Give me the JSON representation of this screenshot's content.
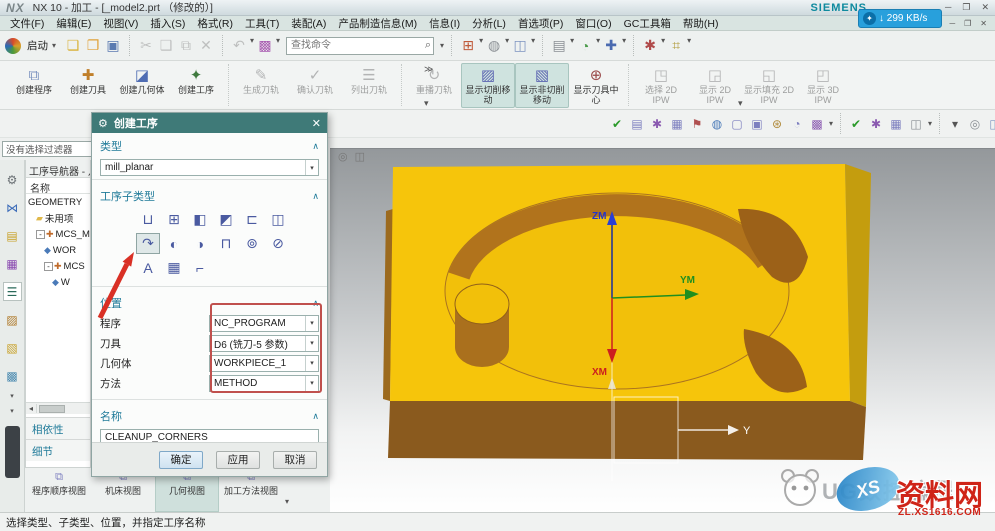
{
  "glyphs": {
    "caret": "▾",
    "overflow": "≫",
    "window_min": "─",
    "window_max": "❐",
    "window_close": "✕",
    "chevron_up": "∧",
    "search": "⌕",
    "gear": "⚙",
    "left_arrow": "◂",
    "net_icon": "✦",
    "globe": "◎",
    "cube": "◫"
  },
  "colors": {
    "accent_teal": "#3f7a78",
    "section_blue": "#1f7a99",
    "highlight_red": "#c0504d",
    "part_yellow": "#f6c50b",
    "wall_brown": "#b1731c",
    "front_brown": "#8a5a1e"
  },
  "window": {
    "app_logo": "NX",
    "title": "NX 10 - 加工 - [_model2.prt （修改的）]",
    "brand": "SIEMENS",
    "net_badge": "↓ 299 KB/s"
  },
  "menu": {
    "items": [
      "文件(F)",
      "编辑(E)",
      "视图(V)",
      "插入(S)",
      "格式(R)",
      "工具(T)",
      "装配(A)",
      "产品制造信息(M)",
      "信息(I)",
      "分析(L)",
      "首选项(P)",
      "窗口(O)",
      "GC工具箱",
      "帮助(H)"
    ]
  },
  "quickbar": {
    "start_label": "启动",
    "search_placeholder": "查找命令",
    "file_icons": [
      {
        "n": "new-file-icon",
        "g": "❏",
        "c": "#d9b23a"
      },
      {
        "n": "open-icon",
        "g": "❐",
        "c": "#e0a23a"
      },
      {
        "n": "save-icon",
        "g": "▣",
        "c": "#5a7ab0"
      }
    ],
    "edit_icons": [
      {
        "n": "cut-icon",
        "g": "✂",
        "c": "#777",
        "d": true
      },
      {
        "n": "copy-icon",
        "g": "❑",
        "c": "#777",
        "d": true
      },
      {
        "n": "paste-icon",
        "g": "⧉",
        "c": "#777",
        "d": true
      },
      {
        "n": "delete-icon",
        "g": "✕",
        "c": "#777",
        "d": true
      }
    ],
    "undo_icons": [
      {
        "n": "undo-icon",
        "g": "↶",
        "c": "#777",
        "d": true,
        "caret": true
      },
      {
        "n": "visual-style-icon",
        "g": "▩",
        "c": "#a85ab0",
        "caret": true
      }
    ],
    "view_icons": [
      {
        "n": "fit-view-icon",
        "g": "⊞",
        "c": "#c05a3a",
        "caret": true
      },
      {
        "n": "shaded-view-icon",
        "g": "◍",
        "c": "#8a8f94",
        "caret": true
      },
      {
        "n": "orient-cube-icon",
        "g": "◫",
        "c": "#7d94c0",
        "caret": true
      }
    ],
    "window_icons": [
      {
        "n": "window-style-icon",
        "g": "▤",
        "c": "#8a8f94",
        "caret": true
      },
      {
        "n": "show-hide-icon",
        "g": "◔",
        "c": "#4a9a4a",
        "caret": true
      },
      {
        "n": "move-object-icon",
        "g": "✚",
        "c": "#4a6ab0",
        "caret": true
      }
    ],
    "misc_icons": [
      {
        "n": "spline-icon",
        "g": "✱",
        "c": "#b04a4a",
        "caret": true
      },
      {
        "n": "measure-icon",
        "g": "⌗",
        "c": "#b09a3a",
        "caret": true
      }
    ]
  },
  "ribbon": {
    "groups": [
      {
        "name": "insert-group",
        "buttons": [
          {
            "name": "create-program-button",
            "label": "创建程序",
            "g": "⧉",
            "c": "#7d94c0",
            "state": "normal"
          },
          {
            "name": "create-tool-button",
            "label": "创建刀具",
            "g": "✚",
            "c": "#c07f2a",
            "state": "normal"
          },
          {
            "name": "create-geometry-button",
            "label": "创建几何体",
            "g": "◪",
            "c": "#4f6db3",
            "state": "normal"
          },
          {
            "name": "create-operation-button",
            "label": "创建工序",
            "g": "✦",
            "c": "#3f7a3f",
            "state": "normal"
          }
        ]
      },
      {
        "name": "operations-group",
        "buttons": [
          {
            "name": "generate-toolpath-button",
            "label": "生成刀轨",
            "g": "✎",
            "c": "#667",
            "state": "disabled"
          },
          {
            "name": "verify-toolpath-button",
            "label": "确认刀轨",
            "g": "✓",
            "c": "#667",
            "state": "disabled"
          },
          {
            "name": "list-toolpath-button",
            "label": "列出刀轨",
            "g": "☰",
            "c": "#667",
            "state": "disabled"
          }
        ]
      },
      {
        "name": "display-group",
        "buttons": [
          {
            "name": "replay-toolpath-button",
            "label": "重播刀轨",
            "g": "↻",
            "c": "#667",
            "state": "disabled"
          },
          {
            "name": "show-cutting-moves-button",
            "label": "显示切削移动",
            "g": "▨",
            "c": "#5a63b0",
            "state": "active"
          },
          {
            "name": "show-noncutting-moves-button",
            "label": "显示非切削移动",
            "g": "▧",
            "c": "#5a63b0",
            "state": "active"
          },
          {
            "name": "show-tool-center-button",
            "label": "显示刀具中心",
            "g": "⊕",
            "c": "#9a4a4a",
            "state": "normal"
          }
        ]
      },
      {
        "name": "ipw-group",
        "buttons": [
          {
            "name": "select-2d-ipw-button",
            "label": "选择 2D IPW",
            "g": "◳",
            "c": "#667",
            "state": "disabled"
          },
          {
            "name": "show-2d-ipw-button",
            "label": "显示 2D IPW",
            "g": "◲",
            "c": "#667",
            "state": "disabled"
          },
          {
            "name": "show-filled-2d-ipw-button",
            "label": "显示填充 2D IPW",
            "g": "◱",
            "c": "#667",
            "state": "disabled"
          },
          {
            "name": "show-3d-ipw-button",
            "label": "显示 3D IPW",
            "g": "◰",
            "c": "#667",
            "state": "disabled"
          }
        ]
      }
    ]
  },
  "utility_strip": {
    "icons": [
      {
        "n": "ok-check-icon",
        "g": "✔",
        "c": "#2a9a2a"
      },
      {
        "n": "sheet-icon",
        "g": "▤",
        "c": "#7d7fbf"
      },
      {
        "n": "flower-doc-icon",
        "g": "✱",
        "c": "#8a5ab0"
      },
      {
        "n": "grid-doc-icon",
        "g": "▦",
        "c": "#7d7fbf"
      },
      {
        "n": "flag-icon",
        "g": "⚑",
        "c": "#b05050"
      },
      {
        "n": "globe-icon",
        "g": "◍",
        "c": "#4a7ab8"
      },
      {
        "n": "window-icon",
        "g": "▢",
        "c": "#7d7fbf"
      },
      {
        "n": "copy-list-icon",
        "g": "▣",
        "c": "#7d7fbf"
      },
      {
        "n": "wrench-icon",
        "g": "⊛",
        "c": "#b08a3a"
      },
      {
        "n": "clock-icon",
        "g": "◔",
        "c": "#7d7fbf"
      },
      {
        "n": "palette-icon",
        "g": "▩",
        "c": "#8a5ab0",
        "caret": true
      },
      {
        "sep": true
      },
      {
        "n": "apply-check-icon",
        "g": "✔",
        "c": "#2a9a2a"
      },
      {
        "n": "flower-icon",
        "g": "✱",
        "c": "#8a5ab0"
      },
      {
        "n": "table-icon",
        "g": "▦",
        "c": "#7d7fbf"
      },
      {
        "n": "wireframe-cube-icon",
        "g": "◫",
        "c": "#8a8f94",
        "caret": true
      },
      {
        "sep": true
      },
      {
        "n": "more-caret-icon",
        "g": "▾",
        "c": "#555"
      },
      {
        "n": "sphere-icon",
        "g": "◎",
        "c": "#8a8f94"
      },
      {
        "n": "solid-cube-icon",
        "g": "◫",
        "c": "#7d94c0"
      }
    ]
  },
  "selection_bar": {
    "filter_value": "没有选择过滤器"
  },
  "resource_bar": {
    "icons": [
      {
        "n": "assembly-navigator-icon",
        "g": "⚙",
        "c": "#6a7074"
      },
      {
        "n": "constraint-navigator-icon",
        "g": "⋈",
        "c": "#3a6ab8"
      },
      {
        "n": "part-navigator-icon",
        "g": "▤",
        "c": "#c9a22a"
      },
      {
        "n": "reuse-library-icon",
        "g": "▦",
        "c": "#8a4ab0"
      },
      {
        "n": "operation-navigator-icon",
        "g": "☰",
        "c": "#2a6a5a",
        "selected": true
      },
      {
        "n": "machining-feature-navigator-icon",
        "g": "▨",
        "c": "#b07a2a"
      },
      {
        "n": "machine-tool-navigator-icon",
        "g": "▧",
        "c": "#c9a22a"
      },
      {
        "n": "roles-icon",
        "g": "▩",
        "c": "#4a8ab0"
      }
    ]
  },
  "navigator": {
    "title": "工序导航器 - 几",
    "column_header": "名称",
    "tree": [
      {
        "label": "GEOMETRY",
        "indent": 0
      },
      {
        "label": "未用项",
        "indent": 1,
        "icon": {
          "n": "folder-icon",
          "g": "▰",
          "c": "#e0b84a"
        }
      },
      {
        "label": "MCS_M",
        "indent": 1,
        "exp": "-",
        "icon": {
          "n": "mcs-icon",
          "g": "✚",
          "c": "#c06a2a"
        }
      },
      {
        "label": "WOR",
        "indent": 2,
        "icon": {
          "n": "workpiece-icon",
          "g": "◆",
          "c": "#4a7ab8"
        }
      },
      {
        "label": "MCS",
        "indent": 2,
        "exp": "-",
        "icon": {
          "n": "mcs-icon",
          "g": "✚",
          "c": "#c06a2a"
        }
      },
      {
        "label": "W",
        "indent": 3,
        "icon": {
          "n": "workpiece-icon",
          "g": "◆",
          "c": "#4a7ab8"
        }
      }
    ],
    "panels": [
      "相依性",
      "细节"
    ]
  },
  "dialog": {
    "title": "创建工序",
    "type_section": {
      "label": "类型",
      "value": "mill_planar"
    },
    "subtype_section": {
      "label": "工序子类型",
      "icons": [
        {
          "n": "floor-wall-icon",
          "g": "⊔",
          "row": 0
        },
        {
          "n": "floor-wall-ipw-icon",
          "g": "⊞",
          "row": 0
        },
        {
          "n": "face-milling-icon",
          "g": "◧",
          "row": 0
        },
        {
          "n": "face-milling-manual-icon",
          "g": "◩",
          "row": 0
        },
        {
          "n": "planar-mill-icon",
          "g": "⊏",
          "row": 0
        },
        {
          "n": "planar-profile-icon",
          "g": "◫",
          "row": 0
        },
        {
          "n": "cleanup-corners-icon",
          "g": "↷",
          "row": 1,
          "selected": true
        },
        {
          "n": "finish-walls-icon",
          "g": "◐",
          "row": 1
        },
        {
          "n": "finish-floor-icon",
          "g": "◑",
          "row": 1
        },
        {
          "n": "groove-milling-icon",
          "g": "⊓",
          "row": 1
        },
        {
          "n": "hole-milling-icon",
          "g": "⊚",
          "row": 1
        },
        {
          "n": "thread-milling-icon",
          "g": "⊘",
          "row": 1
        },
        {
          "n": "planar-text-icon",
          "g": "A",
          "row": 2
        },
        {
          "n": "mill-control-icon",
          "g": "▦",
          "row": 2
        },
        {
          "n": "mill-user-icon",
          "g": "⌐",
          "row": 2
        }
      ]
    },
    "location_section": {
      "label": "位置",
      "rows": [
        {
          "label": "程序",
          "value": "NC_PROGRAM"
        },
        {
          "label": "刀具",
          "value": "D6 (铣刀-5 参数)"
        },
        {
          "label": "几何体",
          "value": "WORKPIECE_1"
        },
        {
          "label": "方法",
          "value": "METHOD"
        }
      ]
    },
    "name_section": {
      "label": "名称",
      "value": "CLEANUP_CORNERS"
    },
    "buttons": {
      "ok": "确定",
      "apply": "应用",
      "cancel": "取消"
    }
  },
  "view_tabs": {
    "tabs": [
      {
        "label": "程序顺序视图",
        "icon": "program-order-view-icon",
        "g": "⧉"
      },
      {
        "label": "机床视图",
        "icon": "machine-tool-view-icon",
        "g": "⧉"
      },
      {
        "label": "几何视图",
        "icon": "geometry-view-icon",
        "g": "⧉",
        "selected": true
      },
      {
        "label": "加工方法视图",
        "icon": "machining-method-view-icon",
        "g": "⧉"
      }
    ]
  },
  "status_bar": {
    "message": "选择类型、子类型、位置，并指定工序名称"
  },
  "viewport": {
    "axis_labels": {
      "zm": "ZM",
      "ym": "YM",
      "xm": "XM",
      "y": "Y"
    },
    "colors": {
      "top_face": "#f6c50b",
      "pocket_floor": "#f2c00a",
      "wall": "#b1731c",
      "fin": "#9c6118",
      "front_face": "#8a5a1e",
      "side": "#c49d0e"
    },
    "watermark": {
      "brand_text": "UG数控编程",
      "logo_text": "XS",
      "site_name": "资料网",
      "site_url": "ZL.XS1616.COM"
    }
  }
}
